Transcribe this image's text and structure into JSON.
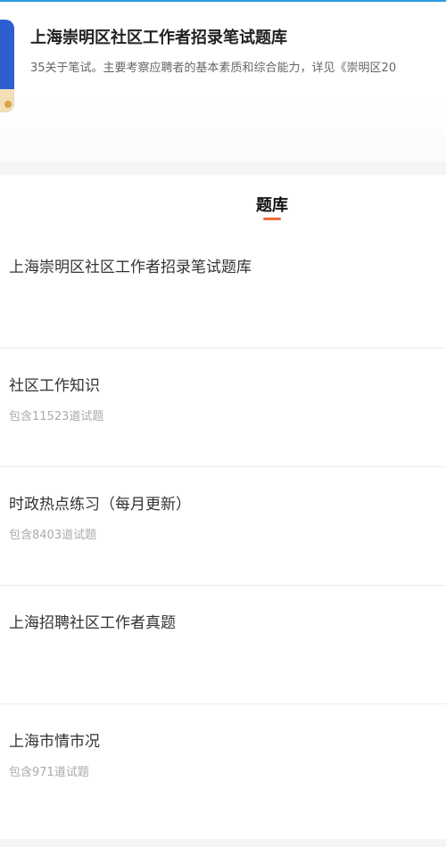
{
  "header": {
    "title": "上海崇明区社区工作者招录笔试题库",
    "description": "35关于笔试。主要考察应聘者的基本素质和综合能力，详见《崇明区20"
  },
  "tab": {
    "label": "题库"
  },
  "items": [
    {
      "title": "上海崇明区社区工作者招录笔试题库",
      "subtitle": ""
    },
    {
      "title": "社区工作知识",
      "subtitle": "包含11523道试题"
    },
    {
      "title": "时政热点练习（每月更新）",
      "subtitle": "包含8403道试题"
    },
    {
      "title": "上海招聘社区工作者真题",
      "subtitle": ""
    },
    {
      "title": "上海市情市况",
      "subtitle": "包含971道试题"
    }
  ],
  "colors": {
    "accent": "#f06a3b",
    "top_bar": "#2b9be6",
    "cover": "#2d5fd0"
  }
}
